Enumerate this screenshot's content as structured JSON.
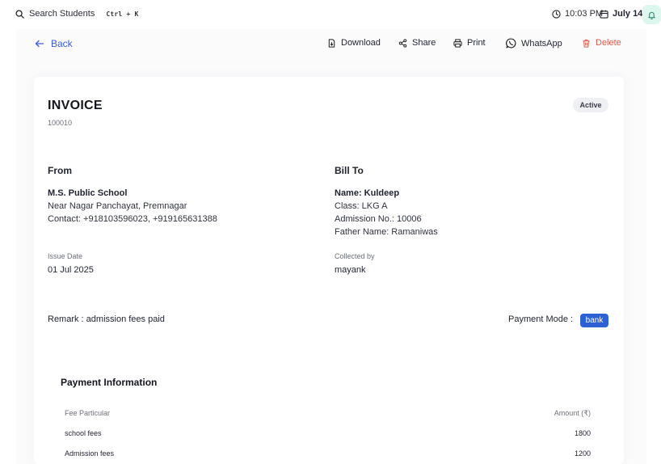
{
  "topbar": {
    "search_label": "Search Students",
    "search_shortcut": "Ctrl + K",
    "time": "10:03 PM",
    "date": "July 14"
  },
  "actions": {
    "back": "Back",
    "download": "Download",
    "share": "Share",
    "print": "Print",
    "whatsapp": "WhatsApp",
    "delete": "Delete"
  },
  "invoice": {
    "title": "INVOICE",
    "number": "100010",
    "status": "Active",
    "from": {
      "heading": "From",
      "name": "M.S. Public School",
      "address": "Near Nagar Panchayat, Premnagar",
      "contact": "Contact: +918103596023, +919165631388"
    },
    "bill_to": {
      "heading": "Bill To",
      "name": "Name: Kuldeep",
      "class": "Class: LKG A",
      "admission_no": "Admission No.: 10006",
      "father_name": "Father Name: Ramaniwas"
    },
    "issue_date_label": "Issue Date",
    "issue_date": "01 Jul 2025",
    "collected_by_label": "Collected by",
    "collected_by": "mayank",
    "remark": "Remark : admission fees paid",
    "payment_mode_label": "Payment Mode :",
    "payment_mode": "bank"
  },
  "payment": {
    "title": "Payment Information",
    "columns": [
      "Fee Particular",
      "Amount (₹)"
    ],
    "rows": [
      {
        "particular": "school fees",
        "amount": "1800"
      },
      {
        "particular": "Admission fees",
        "amount": "1200"
      }
    ]
  },
  "colors": {
    "accent": "#3b5bdb",
    "danger": "#e05a4f",
    "badge_blue": "#2c62d6",
    "bell_bg": "#dcf7ee"
  }
}
